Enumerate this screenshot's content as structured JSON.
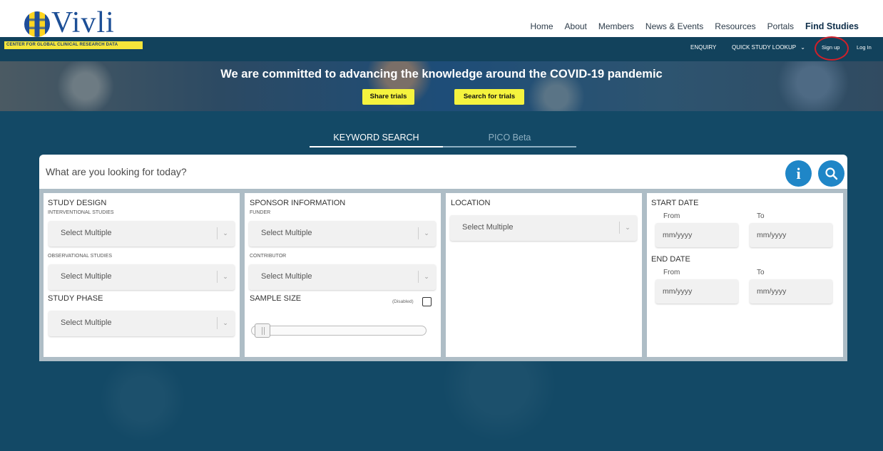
{
  "header": {
    "logo_text": "Vivli",
    "tagline": "CENTER FOR GLOBAL CLINICAL RESEARCH DATA",
    "nav": [
      "Home",
      "About",
      "Members",
      "News & Events",
      "Resources",
      "Portals"
    ],
    "nav_active": "Find Studies"
  },
  "subnav": {
    "enquiry": "ENQUIRY",
    "quick_lookup": "QUICK STUDY LOOKUP",
    "sign_up": "Sign up",
    "log_in": "Log In"
  },
  "banner": {
    "title": "We are committed to advancing the knowledge around the COVID-19 pandemic",
    "share_button": "Share trials",
    "search_button": "Search for trials"
  },
  "tabs": {
    "keyword": "KEYWORD SEARCH",
    "pico": "PICO Beta"
  },
  "search": {
    "placeholder": "What are you looking for today?",
    "info_label": "i"
  },
  "filters": {
    "study_design": {
      "title": "STUDY DESIGN",
      "interventional_label": "INTERVENTIONAL STUDIES",
      "interventional_value": "Select Multiple",
      "observational_label": "OBSERVATIONAL STUDIES",
      "observational_value": "Select Multiple"
    },
    "study_phase": {
      "title": "STUDY PHASE",
      "value": "Select Multiple"
    },
    "sponsor": {
      "title": "SPONSOR INFORMATION",
      "funder_label": "FUNDER",
      "funder_value": "Select Multiple",
      "contributor_label": "CONTRIBUTOR",
      "contributor_value": "Select Multiple"
    },
    "sample_size": {
      "title": "SAMPLE SIZE",
      "disabled_label": "(Disabled)",
      "disabled_checked": false,
      "slider_position": 0
    },
    "location": {
      "title": "LOCATION",
      "value": "Select Multiple"
    },
    "start_date": {
      "title": "START DATE",
      "from_label": "From",
      "to_label": "To",
      "from_placeholder": "mm/yyyy",
      "to_placeholder": "mm/yyyy"
    },
    "end_date": {
      "title": "END DATE",
      "from_label": "From",
      "to_label": "To",
      "from_placeholder": "mm/yyyy",
      "to_placeholder": "mm/yyyy"
    }
  },
  "colors": {
    "brand_blue": "#1d4f96",
    "dark_bg": "#134966",
    "accent_yellow": "#f5f33e",
    "button_blue": "#1f86c7",
    "highlight_red": "#d0202a"
  }
}
